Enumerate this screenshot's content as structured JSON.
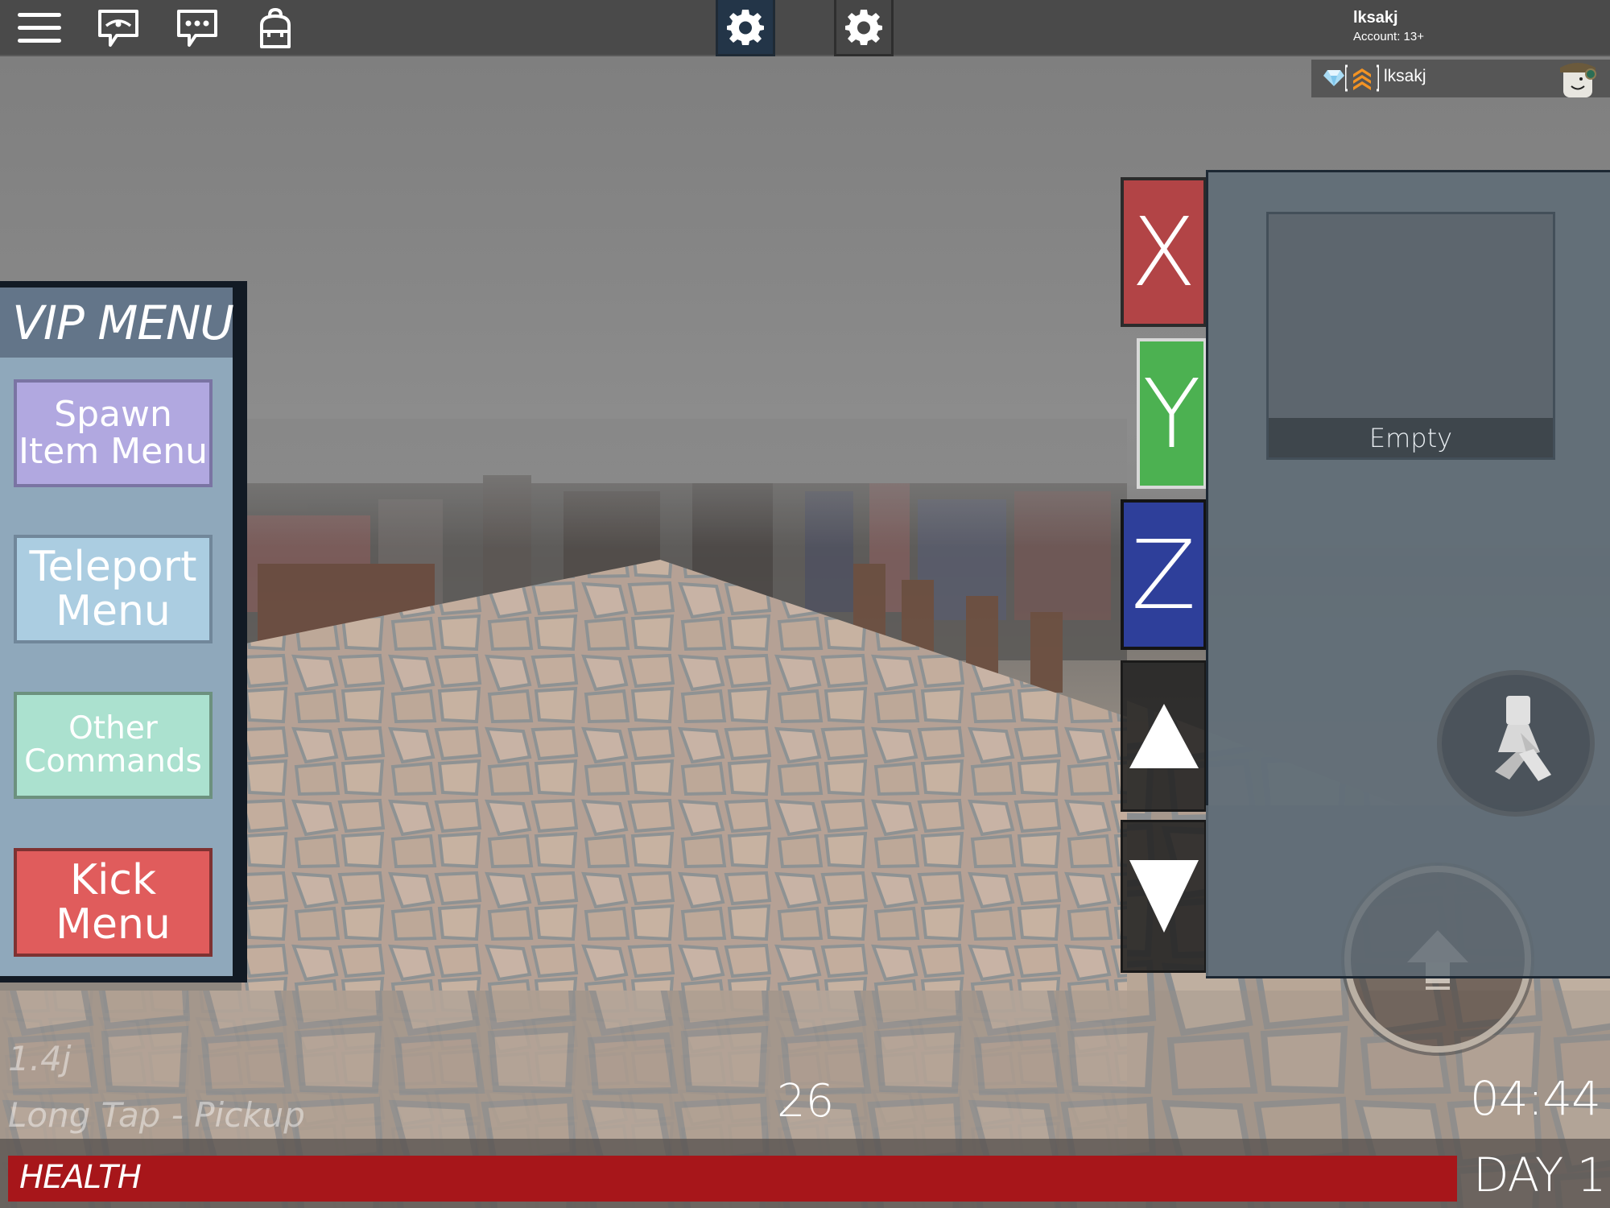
{
  "topbar": {
    "icons": [
      "menu-icon",
      "chat-visibility-icon",
      "chat-icon",
      "backpack-icon"
    ],
    "gear_buttons": [
      "settings-gear-active",
      "settings-gear"
    ],
    "account": {
      "username": "lksakj",
      "age_label": "Account: 13+"
    }
  },
  "playerlist": {
    "player_name": "lksakj",
    "badges": [
      "premium-gem-icon",
      "rank-chevrons-icon"
    ]
  },
  "vip_menu": {
    "title": "VIP MENU",
    "buttons": [
      {
        "line1": "Spawn",
        "line2": "Item Menu",
        "bg": "#b1a8e0",
        "border": "#7a74a3"
      },
      {
        "line1": "Teleport",
        "line2": "Menu",
        "bg": "#abcde1",
        "border": "#71879a"
      },
      {
        "line1": "Other",
        "line2": "Commands",
        "bg": "#abe1cf",
        "border": "#6c917e"
      },
      {
        "line1": "Kick",
        "line2": "Menu",
        "bg": "#e05c5c",
        "border": "#7e3232"
      }
    ]
  },
  "axis_controls": {
    "x": {
      "label": "X",
      "color": "#b24446"
    },
    "y": {
      "label": "Y",
      "color": "#4cb151"
    },
    "z": {
      "label": "Z",
      "color": "#2e3f9a"
    },
    "up_icon": "triangle-up-icon",
    "down_icon": "triangle-down-icon"
  },
  "inventory": {
    "slot_label": "Empty"
  },
  "hud": {
    "version": "1.4j",
    "hint": "Long Tap - Pickup",
    "counter": "26",
    "clock": "04:44",
    "day": "DAY 1",
    "health_label": "HEALTH",
    "health_percent": 100,
    "health_color": "#a7161a"
  }
}
